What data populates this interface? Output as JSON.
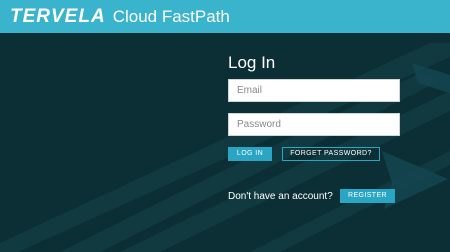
{
  "header": {
    "brand": "TERVELA",
    "product": "Cloud FastPath"
  },
  "login": {
    "title": "Log In",
    "email_placeholder": "Email",
    "password_placeholder": "Password",
    "login_label": "LOG IN",
    "forgot_label": "FORGET PASSWORD?"
  },
  "signup": {
    "prompt": "Don't have an account?",
    "register_label": "REGISTER"
  },
  "colors": {
    "header_bg": "#3ab3cd",
    "page_bg": "#0c2f35",
    "accent": "#2aa5c4"
  }
}
